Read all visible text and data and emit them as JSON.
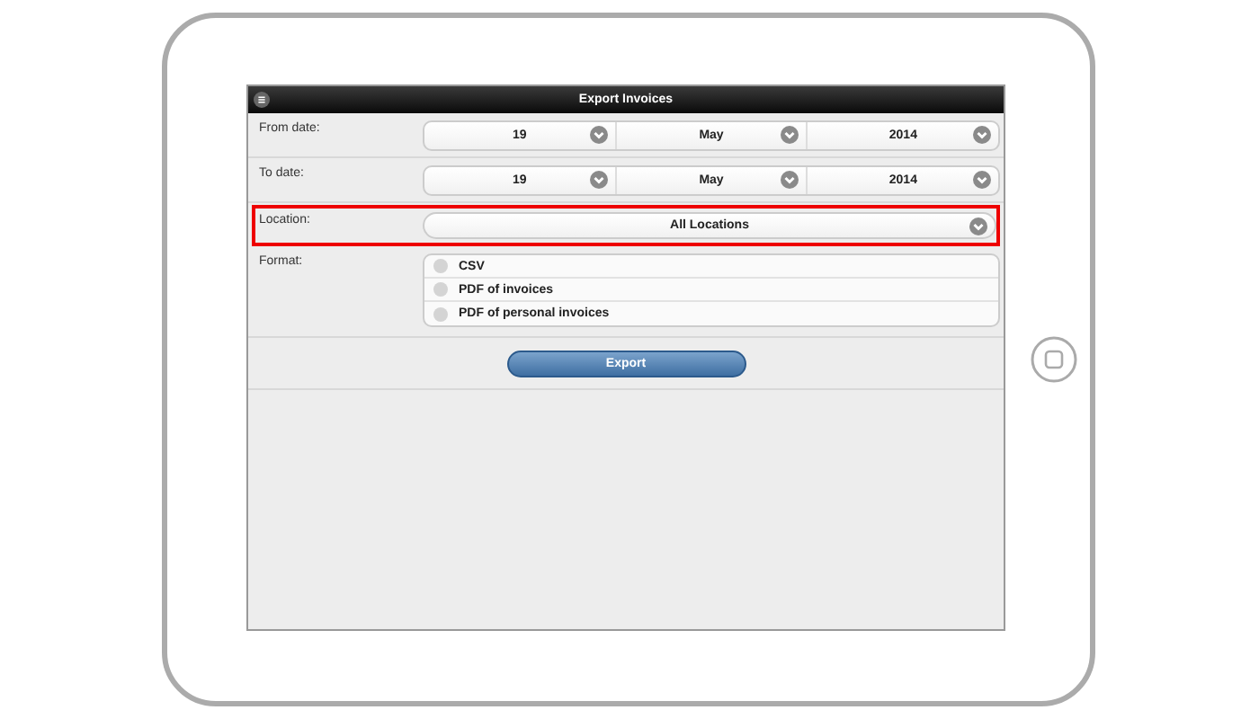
{
  "header": {
    "title": "Export Invoices"
  },
  "date_rows": [
    {
      "label": "From date:",
      "day": "19",
      "month": "May",
      "year": "2014"
    },
    {
      "label": "To date:",
      "day": "19",
      "month": "May",
      "year": "2014"
    }
  ],
  "location": {
    "label": "Location:",
    "value": "All Locations",
    "highlighted": true
  },
  "format": {
    "label": "Format:",
    "options": [
      {
        "label": "CSV",
        "selected": false
      },
      {
        "label": "PDF of invoices",
        "selected": false
      },
      {
        "label": "PDF of personal invoices",
        "selected": false
      }
    ]
  },
  "export_button": "Export"
}
